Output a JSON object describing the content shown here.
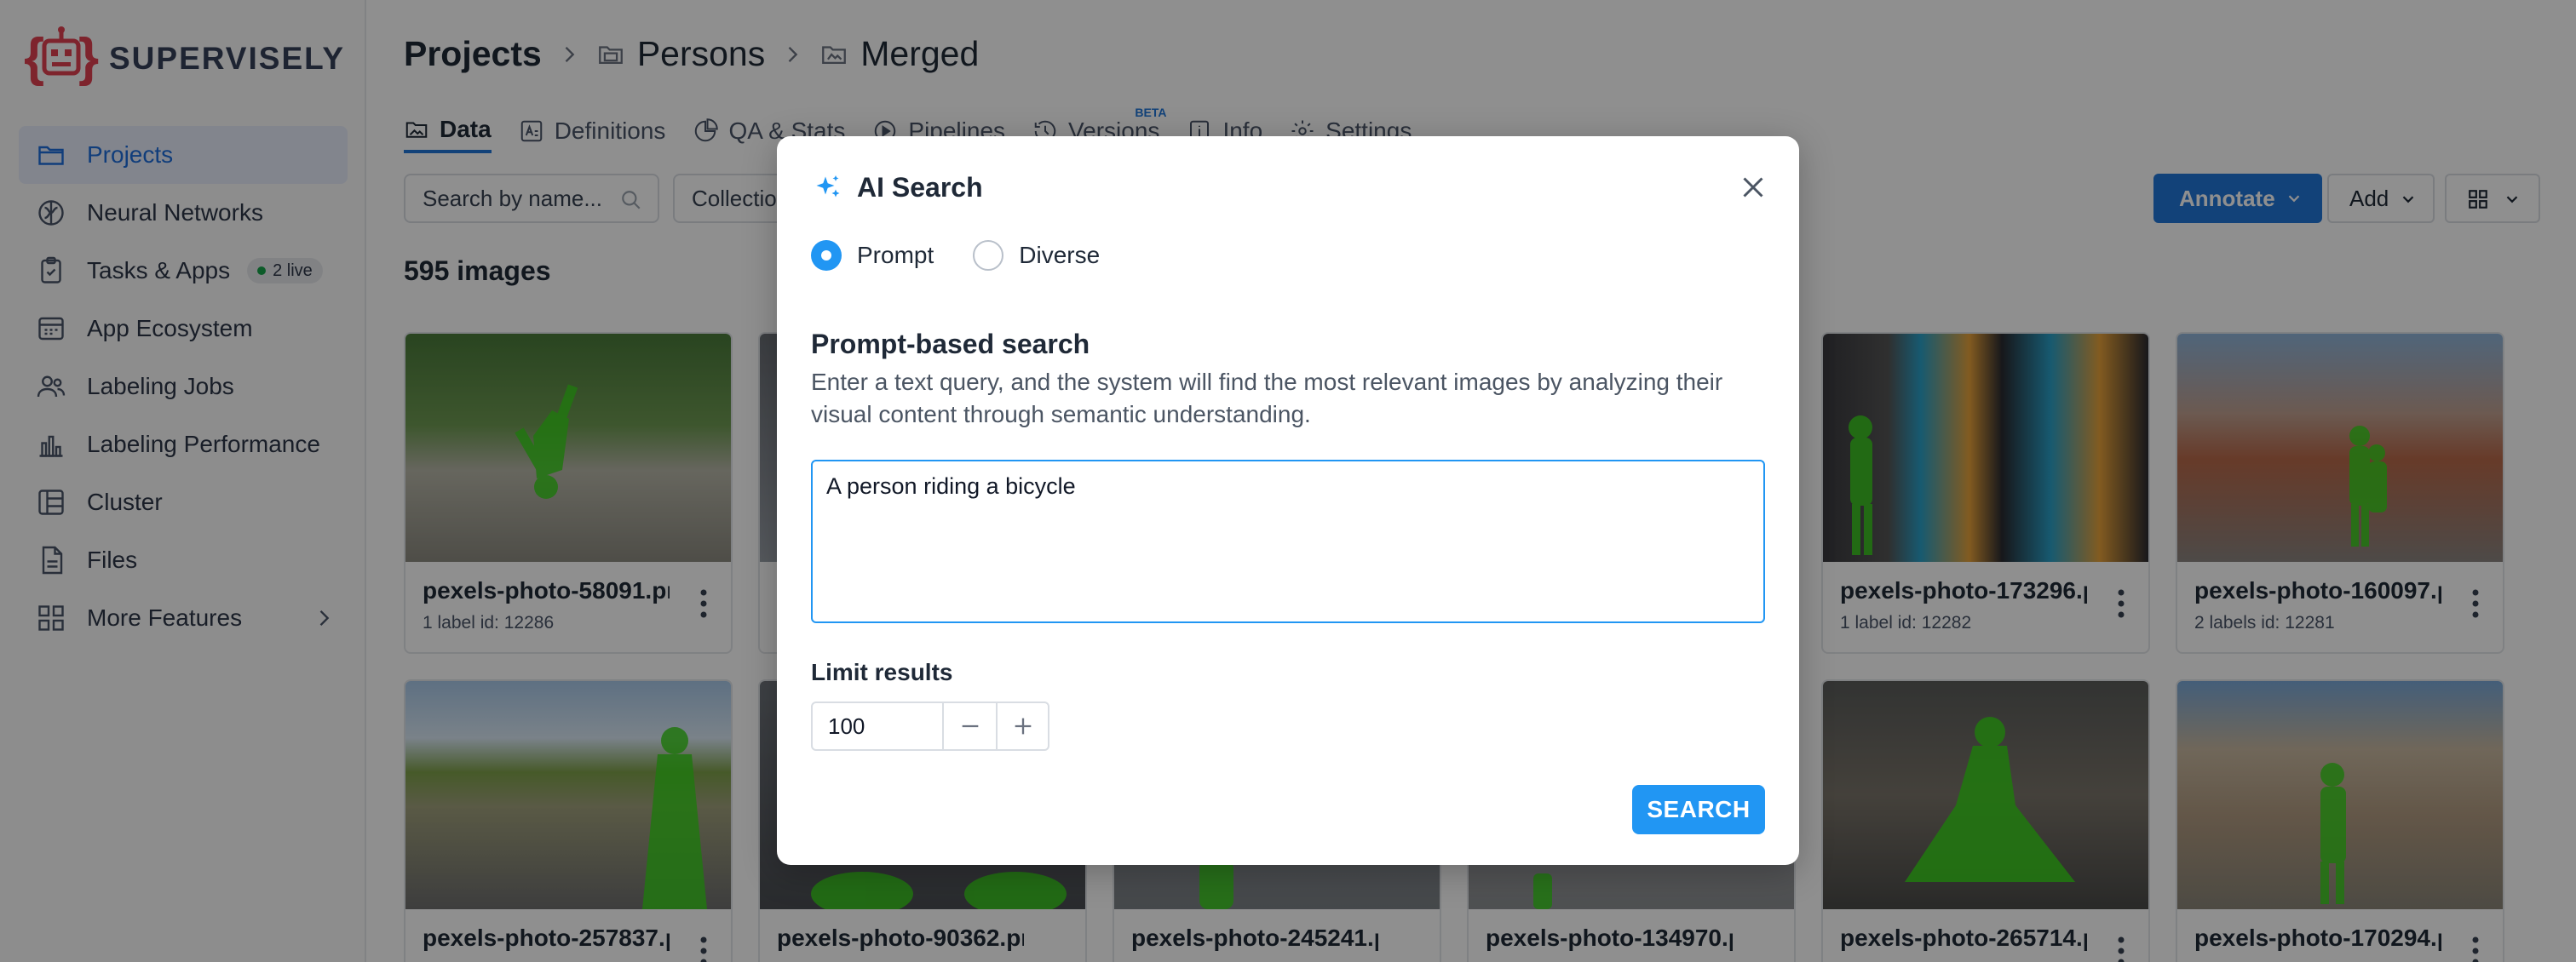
{
  "brand": {
    "name": "SUPERVISELY"
  },
  "sidebar": {
    "items": [
      {
        "label": "Projects",
        "icon": "folder-icon",
        "active": true
      },
      {
        "label": "Neural Networks",
        "icon": "brain-icon"
      },
      {
        "label": "Tasks & Apps",
        "icon": "clipboard-icon",
        "badge": "2 live"
      },
      {
        "label": "App Ecosystem",
        "icon": "app-grid-icon"
      },
      {
        "label": "Labeling Jobs",
        "icon": "people-icon"
      },
      {
        "label": "Labeling Performance",
        "icon": "bar-chart-icon"
      },
      {
        "label": "Cluster",
        "icon": "cluster-icon"
      },
      {
        "label": "Files",
        "icon": "file-icon"
      },
      {
        "label": "More Features",
        "icon": "grid-icon"
      }
    ]
  },
  "breadcrumb": {
    "root": "Projects",
    "project": "Persons",
    "dataset": "Merged"
  },
  "tabs": [
    {
      "label": "Data",
      "active": true
    },
    {
      "label": "Definitions"
    },
    {
      "label": "QA & Stats"
    },
    {
      "label": "Pipelines"
    },
    {
      "label": "Versions",
      "badge": "BETA"
    },
    {
      "label": "Info"
    },
    {
      "label": "Settings"
    }
  ],
  "toolbar": {
    "search_placeholder": "Search by name...",
    "collection_label": "Collection",
    "annotate_label": "Annotate",
    "add_label": "Add"
  },
  "gallery": {
    "count_text": "595 images",
    "cards": [
      {
        "name": "pexels-photo-58091.pr",
        "info": "1 label  id: 12286"
      },
      {
        "name": "",
        "info": ""
      },
      {
        "name": "",
        "info": ""
      },
      {
        "name": "",
        "info": ""
      },
      {
        "name": "pexels-photo-173296.p",
        "info": "1 label  id: 12282"
      },
      {
        "name": "pexels-photo-160097.p",
        "info": "2 labels  id: 12281"
      },
      {
        "name": "pexels-photo-257837.p",
        "info": ""
      },
      {
        "name": "pexels-photo-90362.pr",
        "info": ""
      },
      {
        "name": "pexels-photo-245241.p",
        "info": ""
      },
      {
        "name": "pexels-photo-134970.p",
        "info": ""
      },
      {
        "name": "pexels-photo-265714.p",
        "info": ""
      },
      {
        "name": "pexels-photo-170294.p",
        "info": ""
      }
    ]
  },
  "modal": {
    "title": "AI Search",
    "modes": [
      {
        "label": "Prompt",
        "checked": true
      },
      {
        "label": "Diverse",
        "checked": false
      }
    ],
    "section_title": "Prompt-based search",
    "section_desc": "Enter a text query, and the system will find the most relevant images by analyzing their visual content through semantic understanding.",
    "prompt_value": "A person riding a bicycle",
    "limit_label": "Limit results",
    "limit_value": "100",
    "search_label": "SEARCH"
  },
  "colors": {
    "accent": "#2196f3",
    "primary": "#2176d8",
    "mask": "#3cd21e",
    "live_dot": "#16a34a"
  }
}
